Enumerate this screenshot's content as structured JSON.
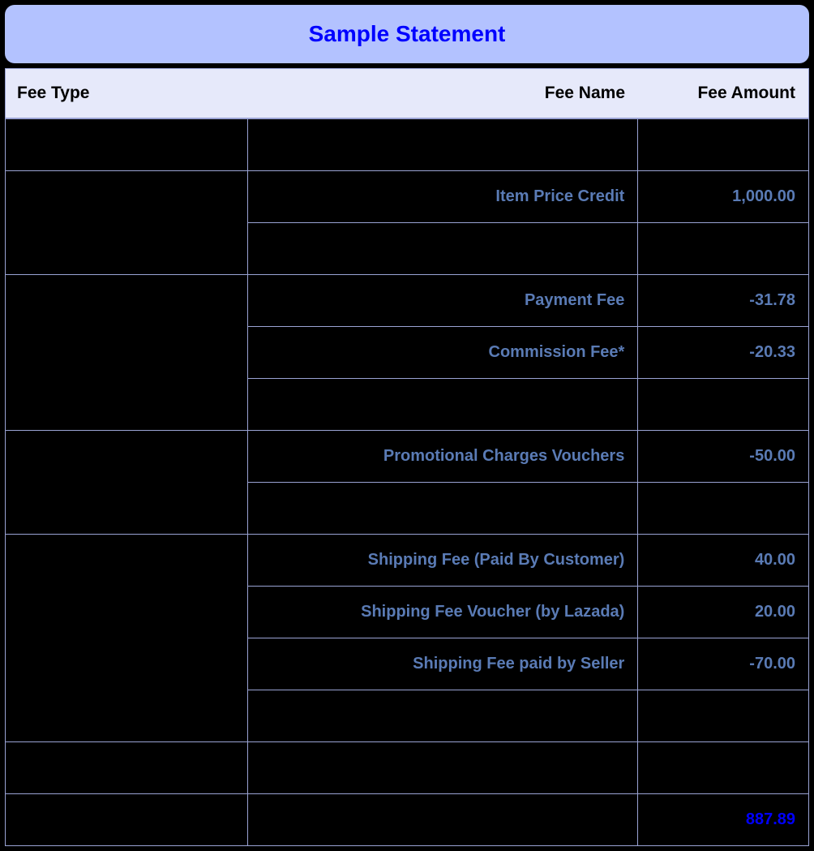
{
  "title": "Sample Statement",
  "columns": {
    "fee_type": "Fee Type",
    "fee_name": "Fee Name",
    "fee_amount": "Fee Amount"
  },
  "rows": [
    {
      "type": "",
      "name": "",
      "amount": ""
    },
    {
      "type": "",
      "name": "Item Price Credit",
      "amount": "1,000.00",
      "rowspan_type": 2
    },
    {
      "name": "",
      "amount": ""
    },
    {
      "type": "",
      "name": "Payment Fee",
      "amount": "-31.78",
      "rowspan_type": 3
    },
    {
      "name": "Commission Fee*",
      "amount": "-20.33"
    },
    {
      "name": "",
      "amount": ""
    },
    {
      "type": "",
      "name": "Promotional Charges Vouchers",
      "amount": "-50.00",
      "rowspan_type": 2
    },
    {
      "name": "",
      "amount": ""
    },
    {
      "type": "",
      "name": "Shipping Fee (Paid By Customer)",
      "amount": "40.00",
      "rowspan_type": 4
    },
    {
      "name": "Shipping Fee Voucher (by Lazada)",
      "amount": "20.00"
    },
    {
      "name": "Shipping Fee paid by Seller",
      "amount": "-70.00"
    },
    {
      "name": "",
      "amount": ""
    },
    {
      "type": "",
      "name": "",
      "amount": ""
    },
    {
      "type": "",
      "name": "",
      "amount": "887.89",
      "total": true
    }
  ],
  "chart_data": {
    "type": "table",
    "title": "Sample Statement",
    "columns": [
      "Fee Type",
      "Fee Name",
      "Fee Amount"
    ],
    "data": [
      {
        "fee_name": "Item Price Credit",
        "fee_amount": 1000.0
      },
      {
        "fee_name": "Payment Fee",
        "fee_amount": -31.78
      },
      {
        "fee_name": "Commission Fee*",
        "fee_amount": -20.33
      },
      {
        "fee_name": "Promotional Charges Vouchers",
        "fee_amount": -50.0
      },
      {
        "fee_name": "Shipping Fee (Paid By Customer)",
        "fee_amount": 40.0
      },
      {
        "fee_name": "Shipping Fee Voucher (by Lazada)",
        "fee_amount": 20.0
      },
      {
        "fee_name": "Shipping Fee paid by Seller",
        "fee_amount": -70.0
      }
    ],
    "total": 887.89
  }
}
